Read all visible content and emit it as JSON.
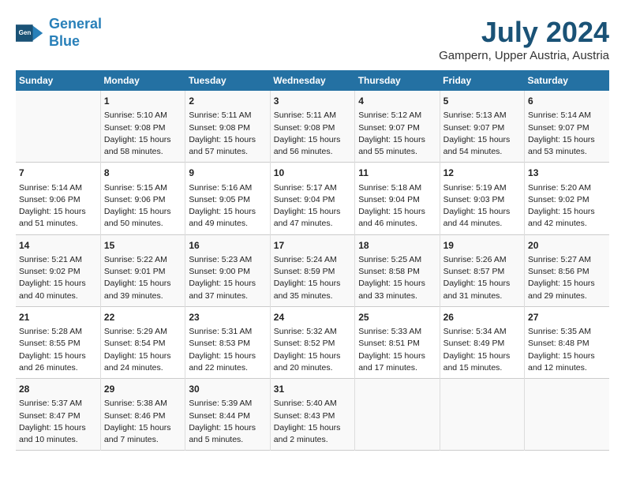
{
  "logo": {
    "line1": "General",
    "line2": "Blue"
  },
  "title": "July 2024",
  "location": "Gampern, Upper Austria, Austria",
  "days_header": [
    "Sunday",
    "Monday",
    "Tuesday",
    "Wednesday",
    "Thursday",
    "Friday",
    "Saturday"
  ],
  "weeks": [
    [
      {
        "num": "",
        "info": ""
      },
      {
        "num": "1",
        "info": "Sunrise: 5:10 AM\nSunset: 9:08 PM\nDaylight: 15 hours\nand 58 minutes."
      },
      {
        "num": "2",
        "info": "Sunrise: 5:11 AM\nSunset: 9:08 PM\nDaylight: 15 hours\nand 57 minutes."
      },
      {
        "num": "3",
        "info": "Sunrise: 5:11 AM\nSunset: 9:08 PM\nDaylight: 15 hours\nand 56 minutes."
      },
      {
        "num": "4",
        "info": "Sunrise: 5:12 AM\nSunset: 9:07 PM\nDaylight: 15 hours\nand 55 minutes."
      },
      {
        "num": "5",
        "info": "Sunrise: 5:13 AM\nSunset: 9:07 PM\nDaylight: 15 hours\nand 54 minutes."
      },
      {
        "num": "6",
        "info": "Sunrise: 5:14 AM\nSunset: 9:07 PM\nDaylight: 15 hours\nand 53 minutes."
      }
    ],
    [
      {
        "num": "7",
        "info": "Sunrise: 5:14 AM\nSunset: 9:06 PM\nDaylight: 15 hours\nand 51 minutes."
      },
      {
        "num": "8",
        "info": "Sunrise: 5:15 AM\nSunset: 9:06 PM\nDaylight: 15 hours\nand 50 minutes."
      },
      {
        "num": "9",
        "info": "Sunrise: 5:16 AM\nSunset: 9:05 PM\nDaylight: 15 hours\nand 49 minutes."
      },
      {
        "num": "10",
        "info": "Sunrise: 5:17 AM\nSunset: 9:04 PM\nDaylight: 15 hours\nand 47 minutes."
      },
      {
        "num": "11",
        "info": "Sunrise: 5:18 AM\nSunset: 9:04 PM\nDaylight: 15 hours\nand 46 minutes."
      },
      {
        "num": "12",
        "info": "Sunrise: 5:19 AM\nSunset: 9:03 PM\nDaylight: 15 hours\nand 44 minutes."
      },
      {
        "num": "13",
        "info": "Sunrise: 5:20 AM\nSunset: 9:02 PM\nDaylight: 15 hours\nand 42 minutes."
      }
    ],
    [
      {
        "num": "14",
        "info": "Sunrise: 5:21 AM\nSunset: 9:02 PM\nDaylight: 15 hours\nand 40 minutes."
      },
      {
        "num": "15",
        "info": "Sunrise: 5:22 AM\nSunset: 9:01 PM\nDaylight: 15 hours\nand 39 minutes."
      },
      {
        "num": "16",
        "info": "Sunrise: 5:23 AM\nSunset: 9:00 PM\nDaylight: 15 hours\nand 37 minutes."
      },
      {
        "num": "17",
        "info": "Sunrise: 5:24 AM\nSunset: 8:59 PM\nDaylight: 15 hours\nand 35 minutes."
      },
      {
        "num": "18",
        "info": "Sunrise: 5:25 AM\nSunset: 8:58 PM\nDaylight: 15 hours\nand 33 minutes."
      },
      {
        "num": "19",
        "info": "Sunrise: 5:26 AM\nSunset: 8:57 PM\nDaylight: 15 hours\nand 31 minutes."
      },
      {
        "num": "20",
        "info": "Sunrise: 5:27 AM\nSunset: 8:56 PM\nDaylight: 15 hours\nand 29 minutes."
      }
    ],
    [
      {
        "num": "21",
        "info": "Sunrise: 5:28 AM\nSunset: 8:55 PM\nDaylight: 15 hours\nand 26 minutes."
      },
      {
        "num": "22",
        "info": "Sunrise: 5:29 AM\nSunset: 8:54 PM\nDaylight: 15 hours\nand 24 minutes."
      },
      {
        "num": "23",
        "info": "Sunrise: 5:31 AM\nSunset: 8:53 PM\nDaylight: 15 hours\nand 22 minutes."
      },
      {
        "num": "24",
        "info": "Sunrise: 5:32 AM\nSunset: 8:52 PM\nDaylight: 15 hours\nand 20 minutes."
      },
      {
        "num": "25",
        "info": "Sunrise: 5:33 AM\nSunset: 8:51 PM\nDaylight: 15 hours\nand 17 minutes."
      },
      {
        "num": "26",
        "info": "Sunrise: 5:34 AM\nSunset: 8:49 PM\nDaylight: 15 hours\nand 15 minutes."
      },
      {
        "num": "27",
        "info": "Sunrise: 5:35 AM\nSunset: 8:48 PM\nDaylight: 15 hours\nand 12 minutes."
      }
    ],
    [
      {
        "num": "28",
        "info": "Sunrise: 5:37 AM\nSunset: 8:47 PM\nDaylight: 15 hours\nand 10 minutes."
      },
      {
        "num": "29",
        "info": "Sunrise: 5:38 AM\nSunset: 8:46 PM\nDaylight: 15 hours\nand 7 minutes."
      },
      {
        "num": "30",
        "info": "Sunrise: 5:39 AM\nSunset: 8:44 PM\nDaylight: 15 hours\nand 5 minutes."
      },
      {
        "num": "31",
        "info": "Sunrise: 5:40 AM\nSunset: 8:43 PM\nDaylight: 15 hours\nand 2 minutes."
      },
      {
        "num": "",
        "info": ""
      },
      {
        "num": "",
        "info": ""
      },
      {
        "num": "",
        "info": ""
      }
    ]
  ]
}
